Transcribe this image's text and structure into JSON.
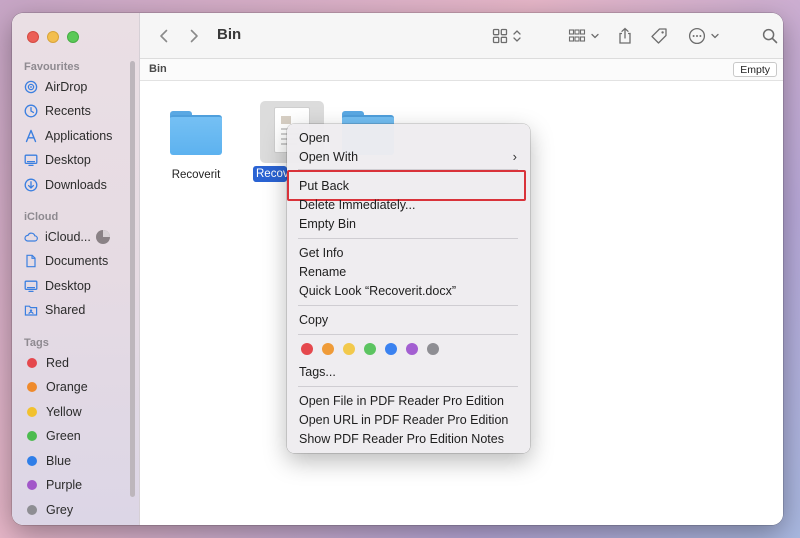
{
  "sidebar": {
    "favourites_header": "Favourites",
    "favourites": [
      {
        "label": "AirDrop",
        "icon": "airdrop-icon"
      },
      {
        "label": "Recents",
        "icon": "clock-icon"
      },
      {
        "label": "Applications",
        "icon": "applications-icon"
      },
      {
        "label": "Desktop",
        "icon": "desktop-icon"
      },
      {
        "label": "Downloads",
        "icon": "downloads-icon"
      }
    ],
    "icloud_header": "iCloud",
    "icloud": [
      {
        "label": "iCloud...",
        "icon": "cloud-icon"
      },
      {
        "label": "Documents",
        "icon": "document-icon"
      },
      {
        "label": "Desktop",
        "icon": "desktop-icon"
      },
      {
        "label": "Shared",
        "icon": "shared-folder-icon"
      }
    ],
    "tags_header": "Tags",
    "tags": [
      {
        "label": "Red",
        "color": "#e5484d"
      },
      {
        "label": "Orange",
        "color": "#ef8a2c"
      },
      {
        "label": "Yellow",
        "color": "#f2c12e"
      },
      {
        "label": "Green",
        "color": "#4cbb4f"
      },
      {
        "label": "Blue",
        "color": "#2f7ee8"
      },
      {
        "label": "Purple",
        "color": "#a257c9"
      },
      {
        "label": "Grey",
        "color": "#8e8e93"
      }
    ]
  },
  "toolbar": {
    "title": "Bin"
  },
  "pathbar": {
    "label": "Bin",
    "empty_button": "Empty"
  },
  "files": [
    {
      "label": "Recoverit",
      "type": "folder"
    },
    {
      "label": "Recov",
      "type": "document",
      "selected": true
    },
    {
      "label": "",
      "type": "folder"
    }
  ],
  "context_menu": {
    "open": "Open",
    "open_with": "Open With",
    "put_back": "Put Back",
    "delete_immediately": "Delete Immediately...",
    "empty_bin": "Empty Bin",
    "get_info": "Get Info",
    "rename": "Rename",
    "quick_look": "Quick Look “Recoverit.docx”",
    "copy": "Copy",
    "tag_colors": [
      "#e5484d",
      "#ef9b38",
      "#f2c94c",
      "#5cc461",
      "#3b82f0",
      "#a35fd1",
      "#8e8e93"
    ],
    "tags": "Tags...",
    "open_file_pdf": "Open File in PDF Reader Pro Edition",
    "open_url_pdf": "Open URL in PDF Reader Pro Edition",
    "show_pdf_notes": "Show PDF Reader Pro Edition Notes"
  },
  "colors": {
    "highlight": "#d9323a",
    "selection": "#2a63d3",
    "accent": "#2f7ee8"
  }
}
